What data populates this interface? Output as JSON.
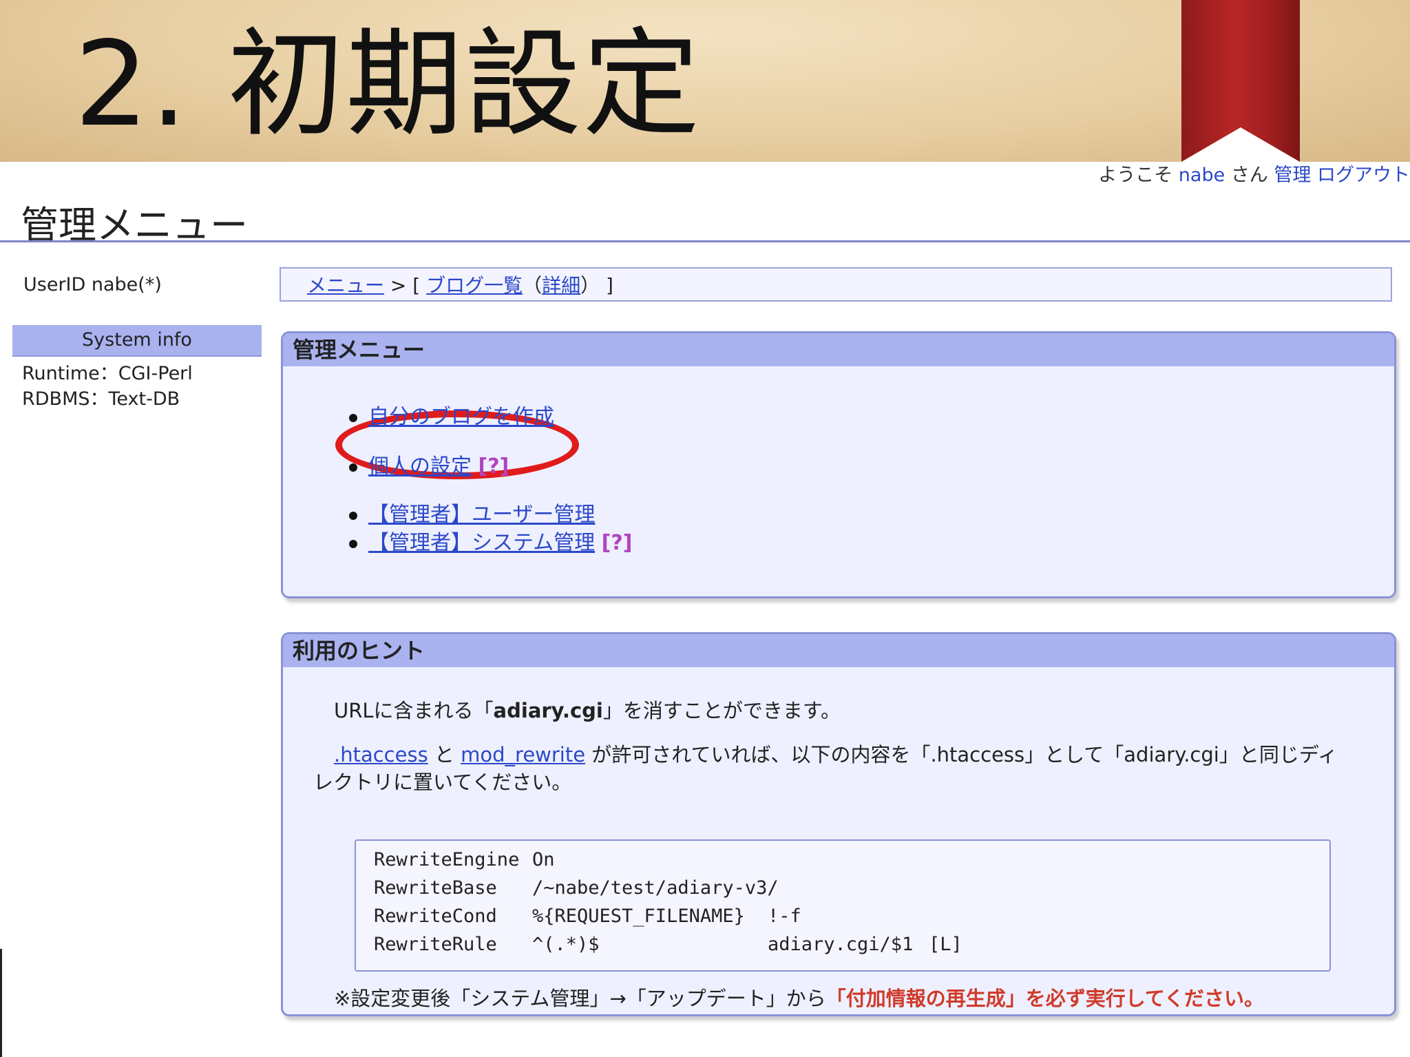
{
  "slide": {
    "title": "2. 初期設定"
  },
  "topbar": {
    "welcome": "ようこそ",
    "user": "nabe",
    "honorific": "さん",
    "admin_link": "管理",
    "logout_link": "ログアウト"
  },
  "page": {
    "heading": "管理メニュー"
  },
  "sidebar": {
    "userid": "UserID nabe(*)",
    "system_info_title": "System info",
    "runtime": "Runtime：CGI-Perl",
    "rdbms": "RDBMS：Text-DB"
  },
  "breadcrumb": {
    "menu_link": "メニュー",
    "sep": " > [ ",
    "blog_list_link": "ブログ一覧",
    "open_paren": "（",
    "detail_link": "詳細",
    "close": "） ]"
  },
  "admin_menu": {
    "title": "管理メニュー",
    "items": [
      {
        "label": "自分のブログを作成",
        "help": ""
      },
      {
        "label": "個人の設定",
        "help": "[?]"
      },
      {
        "label": "【管理者】ユーザー管理",
        "help": ""
      },
      {
        "label": "【管理者】システム管理",
        "help": "[?]"
      }
    ]
  },
  "hints": {
    "title": "利用のヒント",
    "line1_pre": "URLに含まれる「",
    "line1_bold": "adiary.cgi",
    "line1_post": "」を消すことができます。",
    "htaccess_link": ".htaccess",
    "and": " と ",
    "mod_rewrite_link": "mod_rewrite",
    "line2_rest": " が許可されていれば、以下の内容を「.htaccess」として「adiary.cgi」と同じディ",
    "line3": "レクトリに置いてください。",
    "code": [
      [
        "RewriteEngine",
        "On",
        "",
        ""
      ],
      [
        "RewriteBase",
        "/~nabe/test/adiary-v3/",
        "",
        ""
      ],
      [
        "RewriteCond",
        "%{REQUEST_FILENAME}",
        "!-f",
        ""
      ],
      [
        "RewriteRule",
        "^(.*)$",
        "adiary.cgi/$1",
        "[L]"
      ]
    ],
    "note_pre": "※設定変更後「システム管理」→「アップデート」から",
    "note_warn": "「付加情報の再生成」を必ず実行してください。"
  }
}
